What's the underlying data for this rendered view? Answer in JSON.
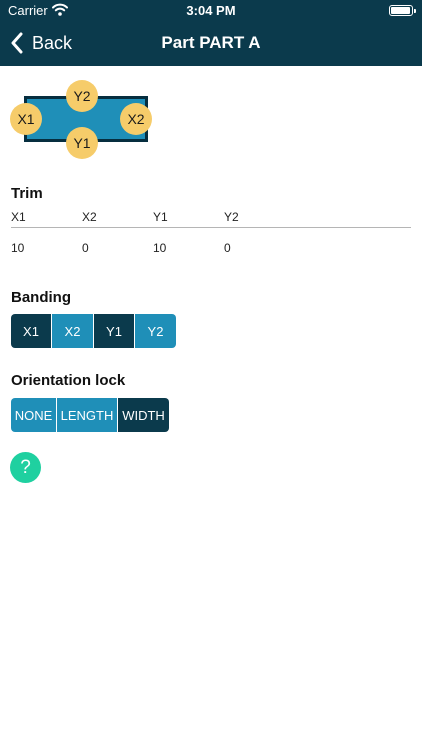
{
  "status_bar": {
    "carrier": "Carrier",
    "time": "3:04 PM"
  },
  "nav": {
    "back_label": "Back",
    "title": "Part PART A"
  },
  "diagram": {
    "labels": {
      "top": "Y2",
      "left": "X1",
      "right": "X2",
      "bottom": "Y1"
    }
  },
  "trim": {
    "title": "Trim",
    "headers": [
      "X1",
      "X2",
      "Y1",
      "Y2"
    ],
    "values": [
      "10",
      "0",
      "10",
      "0"
    ]
  },
  "banding": {
    "title": "Banding",
    "buttons": [
      {
        "label": "X1",
        "state": "selected"
      },
      {
        "label": "X2",
        "state": "unselected"
      },
      {
        "label": "Y1",
        "state": "selected"
      },
      {
        "label": "Y2",
        "state": "unselected"
      }
    ]
  },
  "orientation_lock": {
    "title": "Orientation lock",
    "options": [
      "NONE",
      "LENGTH",
      "WIDTH"
    ],
    "selected": "WIDTH"
  },
  "help": {
    "glyph": "?"
  },
  "colors": {
    "navbar": "#0b3a4c",
    "selected": "#0b3a4c",
    "unselected": "#1f8fb8",
    "badge": "#f6cc6a",
    "help": "#1fd0a0"
  }
}
